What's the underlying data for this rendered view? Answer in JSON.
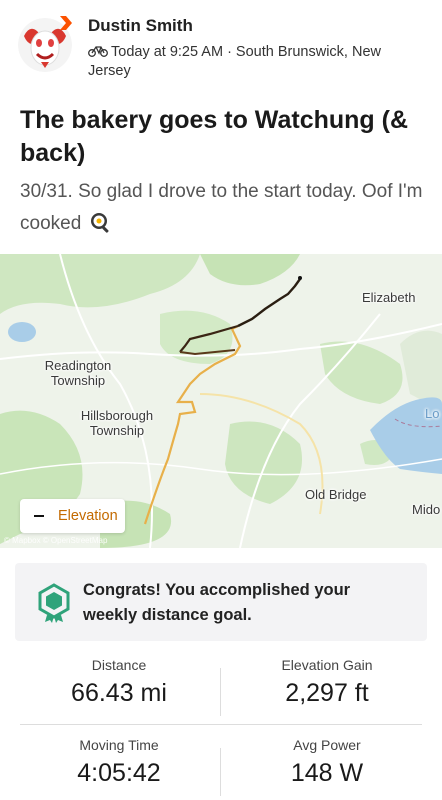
{
  "athlete": {
    "name": "Dustin Smith"
  },
  "activity": {
    "meta": "Today at 9:25 AM · South Brunswick, New Jersey",
    "title": "The bakery goes to Watchung (& back)",
    "description": "30/31.  So glad I drove to the start today. Oof I'm cooked"
  },
  "map": {
    "labels": {
      "elizabeth": "Elizabeth",
      "readington": "Readington Township",
      "hillsborough": "Hillsborough Township",
      "old_bridge": "Old Bridge",
      "lo": "Lo",
      "mid": "Mido"
    },
    "elevation_button": "Elevation",
    "attribution": "© Mapbox © OpenStreetMap",
    "colors": {
      "route_low": "#e8b04a",
      "route_high": "#1f1b17",
      "water": "#a9cde8",
      "green": "#c6e3b5"
    }
  },
  "achievement": {
    "text": "Congrats! You accomplished your weekly distance goal.",
    "icon": "hexagon-medal-icon",
    "color": "#2fa37a"
  },
  "stats": [
    {
      "label": "Distance",
      "value": "66.43 mi"
    },
    {
      "label": "Elevation Gain",
      "value": "2,297 ft"
    },
    {
      "label": "Moving Time",
      "value": "4:05:42"
    },
    {
      "label": "Avg Power",
      "value": "148 W"
    }
  ]
}
